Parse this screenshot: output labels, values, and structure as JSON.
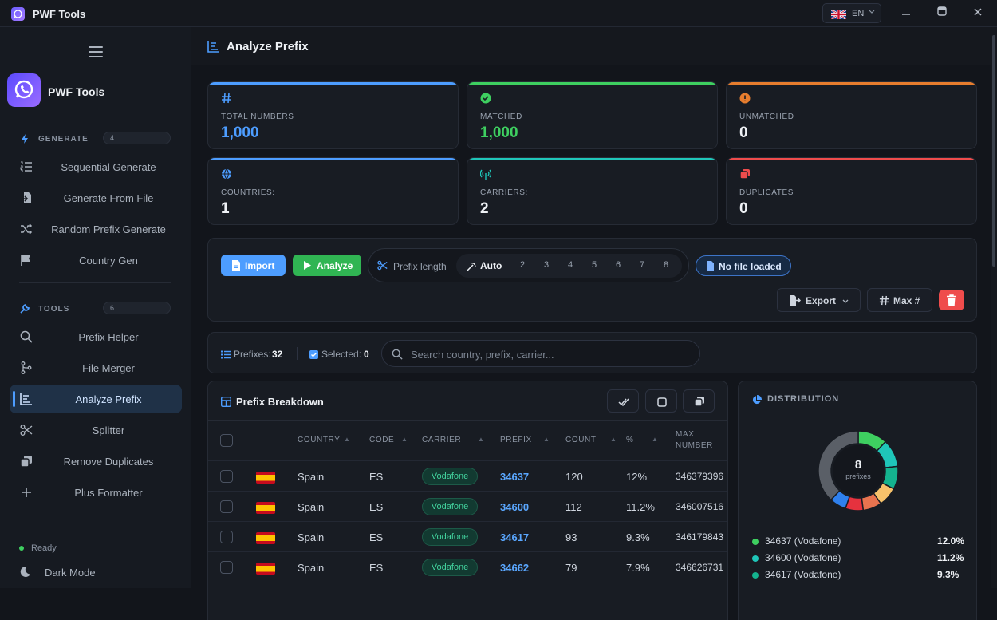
{
  "app": {
    "title": "PWF Tools",
    "lang": "EN"
  },
  "sidebar": {
    "brand": "PWF Tools",
    "generate": {
      "label": "GENERATE",
      "count": "4",
      "items": [
        {
          "label": "Sequential Generate"
        },
        {
          "label": "Generate From File"
        },
        {
          "label": "Random Prefix Generate"
        },
        {
          "label": "Country Gen"
        }
      ]
    },
    "tools": {
      "label": "TOOLS",
      "count": "6",
      "items": [
        {
          "label": "Prefix Helper"
        },
        {
          "label": "File Merger"
        },
        {
          "label": "Analyze Prefix"
        },
        {
          "label": "Splitter"
        },
        {
          "label": "Remove Duplicates"
        },
        {
          "label": "Plus Formatter"
        }
      ]
    },
    "status": "Ready",
    "dark_mode": "Dark Mode"
  },
  "page": {
    "title": "Analyze Prefix"
  },
  "stats": [
    {
      "label": "TOTAL NUMBERS",
      "value": "1,000",
      "color": "#4d9dff"
    },
    {
      "label": "MATCHED",
      "value": "1,000",
      "color": "#3ecf60"
    },
    {
      "label": "UNMATCHED",
      "value": "0",
      "color": "#eef1f5"
    },
    {
      "label": "COUNTRIES:",
      "value": "1",
      "color": "#eef1f5"
    },
    {
      "label": "CARRIERS:",
      "value": "2",
      "color": "#eef1f5"
    },
    {
      "label": "DUPLICATES",
      "value": "0",
      "color": "#eef1f5"
    }
  ],
  "toolbar": {
    "import": "Import",
    "analyze": "Analyze",
    "prefix_length_label": "Prefix length",
    "auto": "Auto",
    "lengths": [
      "2",
      "3",
      "4",
      "5",
      "6",
      "7",
      "8"
    ],
    "file_status": "No file loaded",
    "export": "Export",
    "max": "Max #"
  },
  "filter": {
    "prefixes_label": "Prefixes:",
    "prefixes_count": "32",
    "selected_label": "Selected:",
    "selected_count": "0",
    "search_placeholder": "Search country, prefix, carrier..."
  },
  "table": {
    "title": "Prefix Breakdown",
    "columns": [
      "COUNTRY",
      "CODE",
      "CARRIER",
      "PREFIX",
      "COUNT",
      "%",
      "MAX",
      "NUMBER"
    ],
    "rows": [
      {
        "country": "Spain",
        "code": "ES",
        "carrier": "Vodafone",
        "prefix": "34637",
        "count": "120",
        "pct": "12%",
        "max": "346379396"
      },
      {
        "country": "Spain",
        "code": "ES",
        "carrier": "Vodafone",
        "prefix": "34600",
        "count": "112",
        "pct": "11.2%",
        "max": "346007516"
      },
      {
        "country": "Spain",
        "code": "ES",
        "carrier": "Vodafone",
        "prefix": "34617",
        "count": "93",
        "pct": "9.3%",
        "max": "346179843"
      },
      {
        "country": "Spain",
        "code": "ES",
        "carrier": "Vodafone",
        "prefix": "34662",
        "count": "79",
        "pct": "7.9%",
        "max": "346626731"
      }
    ]
  },
  "distribution": {
    "title": "DISTRIBUTION",
    "center_value": "8",
    "center_label": "prefixes",
    "segments": [
      {
        "value": 12.0,
        "color": "#3ecf60"
      },
      {
        "value": 11.2,
        "color": "#1fc6b9"
      },
      {
        "value": 9.3,
        "color": "#14b38e"
      },
      {
        "value": 7.9,
        "color": "#f7c26b"
      },
      {
        "value": 7.6,
        "color": "#e8734f"
      },
      {
        "value": 7.2,
        "color": "#e5323e"
      },
      {
        "value": 6.8,
        "color": "#2f80ed"
      },
      {
        "value": 38.0,
        "color": "#5a5f67"
      }
    ],
    "legend": [
      {
        "name": "34637 (Vodafone)",
        "pct": "12.0%",
        "color": "#3ecf60"
      },
      {
        "name": "34600 (Vodafone)",
        "pct": "11.2%",
        "color": "#1fc6b9"
      },
      {
        "name": "34617 (Vodafone)",
        "pct": "9.3%",
        "color": "#14b38e"
      }
    ]
  }
}
